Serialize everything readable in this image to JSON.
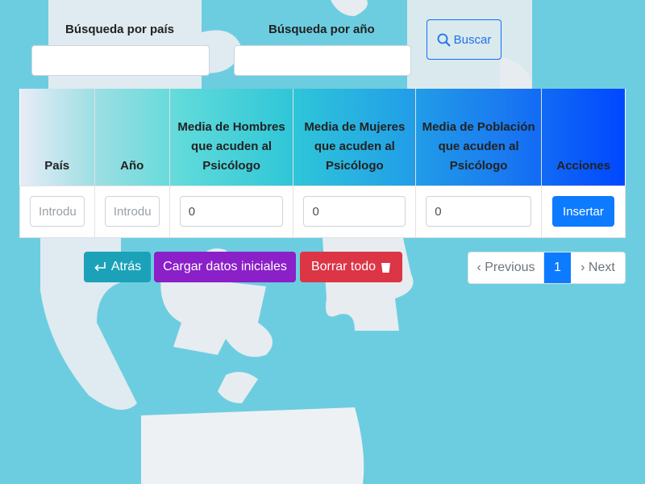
{
  "search": {
    "country_label": "Búsqueda por país",
    "country_value": "",
    "year_label": "Búsqueda por año",
    "year_value": "",
    "button_label": "Buscar"
  },
  "table": {
    "headers": [
      "País",
      "Año",
      "Media de Hombres que acuden al Psicólogo",
      "Media de Mujeres que acuden al Psicólogo",
      "Media de Población que acuden al Psicólogo",
      "Acciones"
    ],
    "new_row": {
      "country_placeholder": "Introduce",
      "year_placeholder": "Introduce",
      "men_value": "0",
      "women_value": "0",
      "population_value": "0",
      "insert_label": "Insertar"
    }
  },
  "actions": {
    "back_label": "Atrás",
    "load_label": "Cargar datos iniciales",
    "delete_label": "Borrar todo"
  },
  "pagination": {
    "previous_label": "‹ Previous",
    "current_page": "1",
    "next_label": "› Next"
  },
  "colors": {
    "back": "#1ba2b8",
    "load": "#8b1fc8",
    "delete": "#dc3545",
    "insert": "#0d7bff",
    "page_active": "#0d7bff"
  }
}
